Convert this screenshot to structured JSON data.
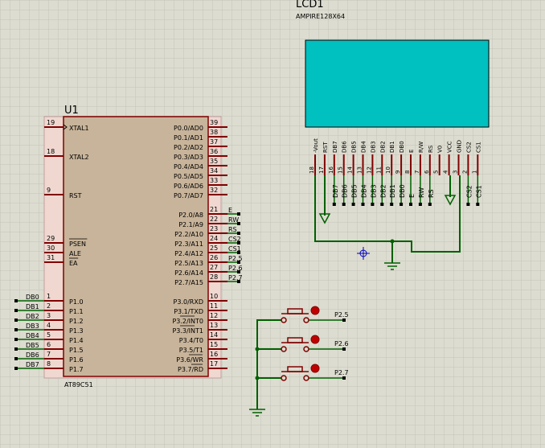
{
  "lcd": {
    "ref": "LCD1",
    "model": "AMPIRE128X64",
    "pins": [
      {
        "num": "18",
        "name": "-Vout",
        "net": ""
      },
      {
        "num": "17",
        "name": "RST",
        "net": ""
      },
      {
        "num": "16",
        "name": "DB7",
        "net": "DB7"
      },
      {
        "num": "15",
        "name": "DB6",
        "net": "DB6"
      },
      {
        "num": "14",
        "name": "DB5",
        "net": "DB5"
      },
      {
        "num": "13",
        "name": "DB4",
        "net": "DB4"
      },
      {
        "num": "12",
        "name": "DB3",
        "net": "DB3"
      },
      {
        "num": "11",
        "name": "DB2",
        "net": "DB2"
      },
      {
        "num": "10",
        "name": "DB1",
        "net": "DB1"
      },
      {
        "num": "9",
        "name": "DB0",
        "net": "DB0"
      },
      {
        "num": "8",
        "name": "E",
        "net": "E"
      },
      {
        "num": "7",
        "name": "R/W",
        "net": "RW"
      },
      {
        "num": "6",
        "name": "RS",
        "net": "RS"
      },
      {
        "num": "5",
        "name": "V0",
        "net": ""
      },
      {
        "num": "4",
        "name": "VCC",
        "net": ""
      },
      {
        "num": "3",
        "name": "GND",
        "net": ""
      },
      {
        "num": "2",
        "name": "CS2",
        "net": "CS2"
      },
      {
        "num": "1",
        "name": "CS1",
        "net": "CS1"
      }
    ]
  },
  "mcu": {
    "ref": "U1",
    "part": "AT89C51",
    "left_pins": [
      {
        "num": "19",
        "name": "XTAL1",
        "net": ""
      },
      {
        "num": "18",
        "name": "XTAL2",
        "net": ""
      },
      {
        "num": "9",
        "name": "RST",
        "net": ""
      },
      {
        "num": "29",
        "name": "PSEN",
        "net": ""
      },
      {
        "num": "30",
        "name": "ALE",
        "net": ""
      },
      {
        "num": "31",
        "name": "EA",
        "net": ""
      },
      {
        "num": "1",
        "name": "P1.0",
        "net": "DB0"
      },
      {
        "num": "2",
        "name": "P1.1",
        "net": "DB1"
      },
      {
        "num": "3",
        "name": "P1.2",
        "net": "DB2"
      },
      {
        "num": "4",
        "name": "P1.3",
        "net": "DB3"
      },
      {
        "num": "5",
        "name": "P1.4",
        "net": "DB4"
      },
      {
        "num": "6",
        "name": "P1.5",
        "net": "DB5"
      },
      {
        "num": "7",
        "name": "P1.6",
        "net": "DB6"
      },
      {
        "num": "8",
        "name": "P1.7",
        "net": "DB7"
      }
    ],
    "right_pins": [
      {
        "num": "39",
        "name": "P0.0/AD0",
        "net": ""
      },
      {
        "num": "38",
        "name": "P0.1/AD1",
        "net": ""
      },
      {
        "num": "37",
        "name": "P0.2/AD2",
        "net": ""
      },
      {
        "num": "36",
        "name": "P0.3/AD3",
        "net": ""
      },
      {
        "num": "35",
        "name": "P0.4/AD4",
        "net": ""
      },
      {
        "num": "34",
        "name": "P0.5/AD5",
        "net": ""
      },
      {
        "num": "33",
        "name": "P0.6/AD6",
        "net": ""
      },
      {
        "num": "32",
        "name": "P0.7/AD7",
        "net": ""
      },
      {
        "num": "21",
        "name": "P2.0/A8",
        "net": "E"
      },
      {
        "num": "22",
        "name": "P2.1/A9",
        "net": "RW"
      },
      {
        "num": "23",
        "name": "P2.2/A10",
        "net": "RS"
      },
      {
        "num": "24",
        "name": "P2.3/A11",
        "net": "CS2"
      },
      {
        "num": "25",
        "name": "P2.4/A12",
        "net": "CS1"
      },
      {
        "num": "26",
        "name": "P2.5/A13",
        "net": "P2.5"
      },
      {
        "num": "27",
        "name": "P2.6/A14",
        "net": "P2.6"
      },
      {
        "num": "28",
        "name": "P2.7/A15",
        "net": "P2.7"
      },
      {
        "num": "10",
        "name": "P3.0/RXD",
        "net": ""
      },
      {
        "num": "11",
        "name": "P3.1/TXD",
        "net": ""
      },
      {
        "num": "12",
        "name": "P3.2/INT0",
        "net": ""
      },
      {
        "num": "13",
        "name": "P3.3/INT1",
        "net": ""
      },
      {
        "num": "14",
        "name": "P3.4/T0",
        "net": ""
      },
      {
        "num": "15",
        "name": "P3.5/T1",
        "net": ""
      },
      {
        "num": "16",
        "name": "P3.6/WR",
        "net": ""
      },
      {
        "num": "17",
        "name": "P3.7/RD",
        "net": ""
      }
    ]
  },
  "buttons": [
    {
      "net": "P2.5"
    },
    {
      "net": "P2.6"
    },
    {
      "net": "P2.7"
    }
  ],
  "colors": {
    "background": "#dcdcd0",
    "wire": "#006000",
    "pin": "#800000",
    "chip_body": "#c8b49a",
    "lcd_screen": "#00c0c0",
    "label": "#000000"
  }
}
